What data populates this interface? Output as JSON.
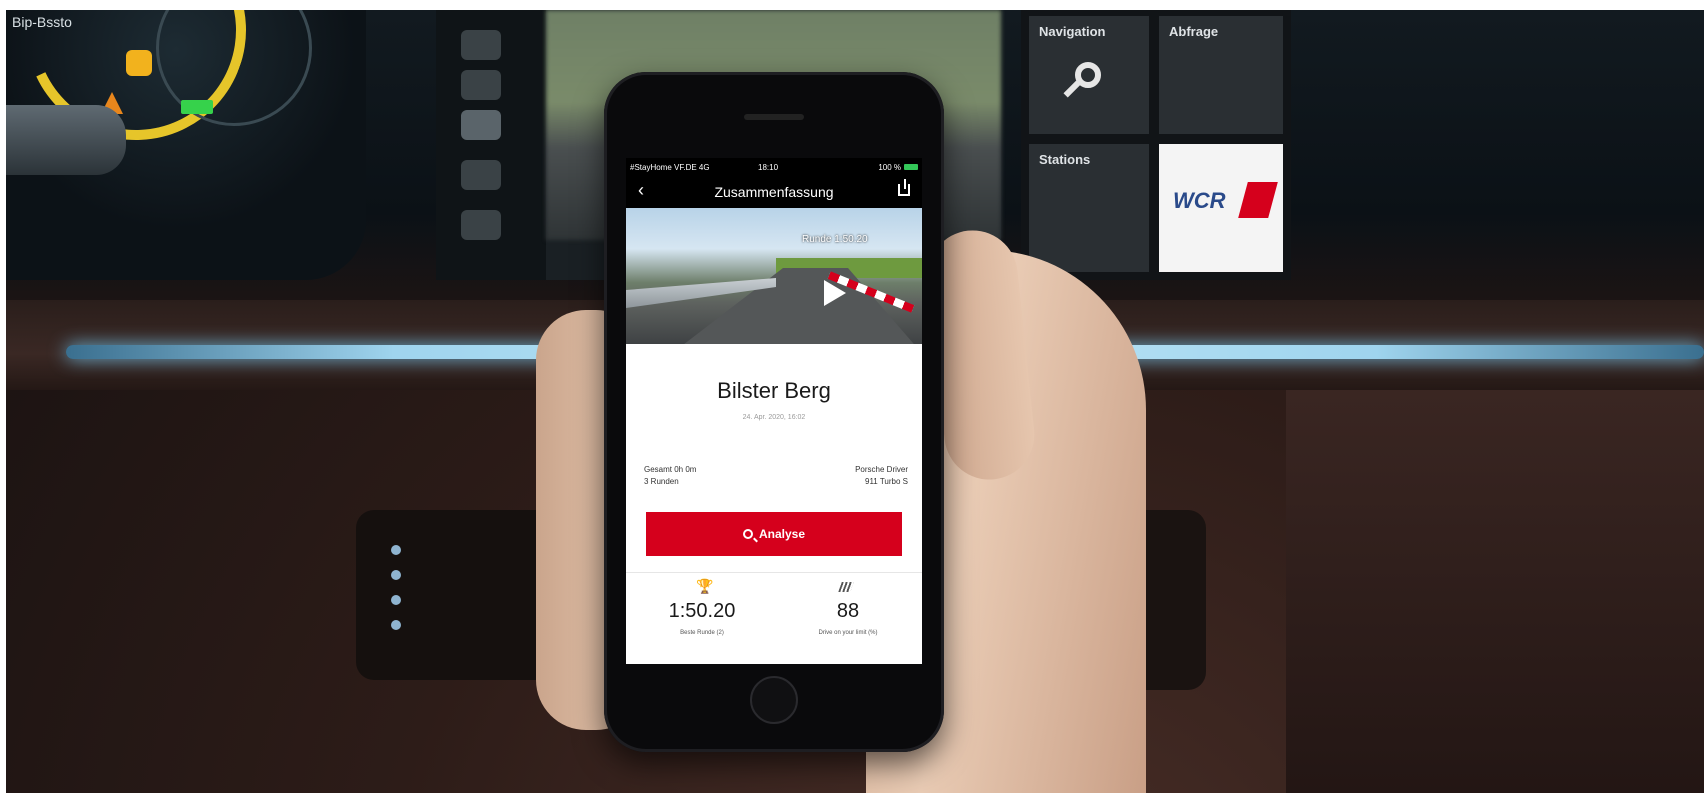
{
  "background": {
    "cluster_label": "Bip-Bssto",
    "tile_labels": [
      "Navigation",
      "Abfrage",
      "Stations"
    ],
    "wcr_text": "WCR"
  },
  "phone": {
    "statusbar": {
      "left": "#StayHome VF.DE 4G",
      "time": "18:10",
      "right": "100 %"
    },
    "nav": {
      "title": "Zusammenfassung",
      "back_glyph": "‹"
    },
    "video": {
      "lap_overlay": "Runde 1:50.20"
    },
    "session": {
      "track_name": "Bilster Berg",
      "date": "24. Apr. 2020, 16:02",
      "left_meta_line1": "Gesamt 0h 0m",
      "left_meta_line2": "3 Runden",
      "right_meta_line1": "Porsche Driver",
      "right_meta_line2": "911 Turbo S"
    },
    "analyse_label": "Analyse",
    "stats": {
      "best_lap_value": "1:50.20",
      "best_lap_label": "Beste Runde (2)",
      "score_value": "88",
      "score_label": "Drive on your limit (%)"
    }
  },
  "colors": {
    "accent_red": "#d5001c",
    "ambient_light": "#9fd4ee"
  }
}
